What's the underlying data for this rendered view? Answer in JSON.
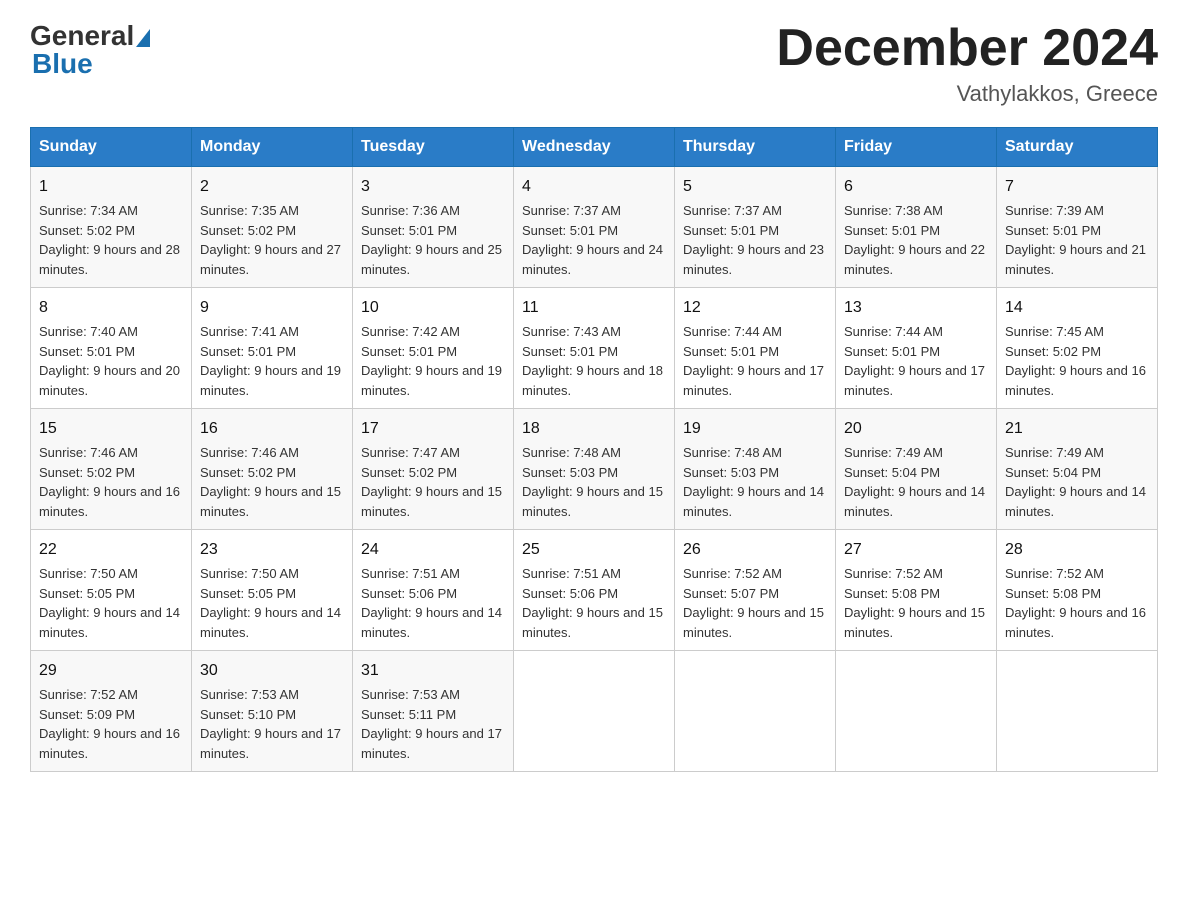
{
  "header": {
    "logo_general": "General",
    "logo_blue": "Blue",
    "month_title": "December 2024",
    "location": "Vathylakkos, Greece"
  },
  "weekdays": [
    "Sunday",
    "Monday",
    "Tuesday",
    "Wednesday",
    "Thursday",
    "Friday",
    "Saturday"
  ],
  "weeks": [
    [
      {
        "day": "1",
        "sunrise": "7:34 AM",
        "sunset": "5:02 PM",
        "daylight": "9 hours and 28 minutes."
      },
      {
        "day": "2",
        "sunrise": "7:35 AM",
        "sunset": "5:02 PM",
        "daylight": "9 hours and 27 minutes."
      },
      {
        "day": "3",
        "sunrise": "7:36 AM",
        "sunset": "5:01 PM",
        "daylight": "9 hours and 25 minutes."
      },
      {
        "day": "4",
        "sunrise": "7:37 AM",
        "sunset": "5:01 PM",
        "daylight": "9 hours and 24 minutes."
      },
      {
        "day": "5",
        "sunrise": "7:37 AM",
        "sunset": "5:01 PM",
        "daylight": "9 hours and 23 minutes."
      },
      {
        "day": "6",
        "sunrise": "7:38 AM",
        "sunset": "5:01 PM",
        "daylight": "9 hours and 22 minutes."
      },
      {
        "day": "7",
        "sunrise": "7:39 AM",
        "sunset": "5:01 PM",
        "daylight": "9 hours and 21 minutes."
      }
    ],
    [
      {
        "day": "8",
        "sunrise": "7:40 AM",
        "sunset": "5:01 PM",
        "daylight": "9 hours and 20 minutes."
      },
      {
        "day": "9",
        "sunrise": "7:41 AM",
        "sunset": "5:01 PM",
        "daylight": "9 hours and 19 minutes."
      },
      {
        "day": "10",
        "sunrise": "7:42 AM",
        "sunset": "5:01 PM",
        "daylight": "9 hours and 19 minutes."
      },
      {
        "day": "11",
        "sunrise": "7:43 AM",
        "sunset": "5:01 PM",
        "daylight": "9 hours and 18 minutes."
      },
      {
        "day": "12",
        "sunrise": "7:44 AM",
        "sunset": "5:01 PM",
        "daylight": "9 hours and 17 minutes."
      },
      {
        "day": "13",
        "sunrise": "7:44 AM",
        "sunset": "5:01 PM",
        "daylight": "9 hours and 17 minutes."
      },
      {
        "day": "14",
        "sunrise": "7:45 AM",
        "sunset": "5:02 PM",
        "daylight": "9 hours and 16 minutes."
      }
    ],
    [
      {
        "day": "15",
        "sunrise": "7:46 AM",
        "sunset": "5:02 PM",
        "daylight": "9 hours and 16 minutes."
      },
      {
        "day": "16",
        "sunrise": "7:46 AM",
        "sunset": "5:02 PM",
        "daylight": "9 hours and 15 minutes."
      },
      {
        "day": "17",
        "sunrise": "7:47 AM",
        "sunset": "5:02 PM",
        "daylight": "9 hours and 15 minutes."
      },
      {
        "day": "18",
        "sunrise": "7:48 AM",
        "sunset": "5:03 PM",
        "daylight": "9 hours and 15 minutes."
      },
      {
        "day": "19",
        "sunrise": "7:48 AM",
        "sunset": "5:03 PM",
        "daylight": "9 hours and 14 minutes."
      },
      {
        "day": "20",
        "sunrise": "7:49 AM",
        "sunset": "5:04 PM",
        "daylight": "9 hours and 14 minutes."
      },
      {
        "day": "21",
        "sunrise": "7:49 AM",
        "sunset": "5:04 PM",
        "daylight": "9 hours and 14 minutes."
      }
    ],
    [
      {
        "day": "22",
        "sunrise": "7:50 AM",
        "sunset": "5:05 PM",
        "daylight": "9 hours and 14 minutes."
      },
      {
        "day": "23",
        "sunrise": "7:50 AM",
        "sunset": "5:05 PM",
        "daylight": "9 hours and 14 minutes."
      },
      {
        "day": "24",
        "sunrise": "7:51 AM",
        "sunset": "5:06 PM",
        "daylight": "9 hours and 14 minutes."
      },
      {
        "day": "25",
        "sunrise": "7:51 AM",
        "sunset": "5:06 PM",
        "daylight": "9 hours and 15 minutes."
      },
      {
        "day": "26",
        "sunrise": "7:52 AM",
        "sunset": "5:07 PM",
        "daylight": "9 hours and 15 minutes."
      },
      {
        "day": "27",
        "sunrise": "7:52 AM",
        "sunset": "5:08 PM",
        "daylight": "9 hours and 15 minutes."
      },
      {
        "day": "28",
        "sunrise": "7:52 AM",
        "sunset": "5:08 PM",
        "daylight": "9 hours and 16 minutes."
      }
    ],
    [
      {
        "day": "29",
        "sunrise": "7:52 AM",
        "sunset": "5:09 PM",
        "daylight": "9 hours and 16 minutes."
      },
      {
        "day": "30",
        "sunrise": "7:53 AM",
        "sunset": "5:10 PM",
        "daylight": "9 hours and 17 minutes."
      },
      {
        "day": "31",
        "sunrise": "7:53 AM",
        "sunset": "5:11 PM",
        "daylight": "9 hours and 17 minutes."
      },
      null,
      null,
      null,
      null
    ]
  ]
}
